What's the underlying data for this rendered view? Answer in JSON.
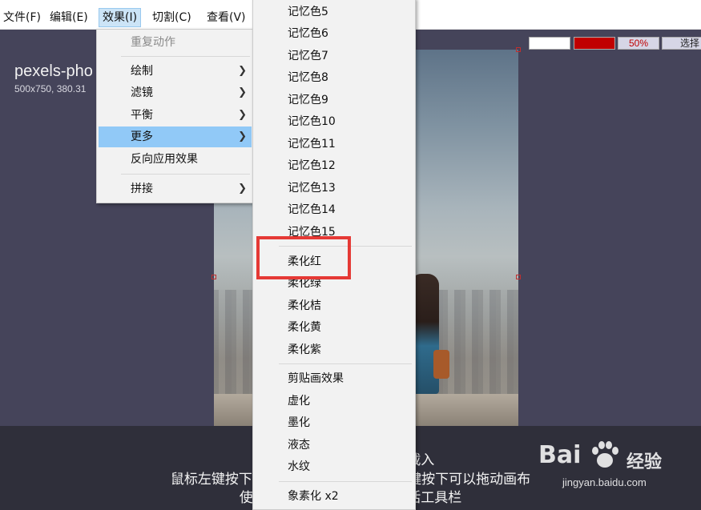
{
  "menubar": {
    "items": [
      {
        "label": "文件(F)"
      },
      {
        "label": "编辑(E)"
      },
      {
        "label": "效果(I)"
      },
      {
        "label": "切割(C)"
      },
      {
        "label": "查看(V)"
      }
    ]
  },
  "image": {
    "title": "pexels-pho",
    "info": "500x750, 380.31"
  },
  "controls": {
    "zoom": "50%",
    "select": "选择",
    "swatch_white": "#ffffff",
    "swatch_red": "#c00000"
  },
  "effects_menu": {
    "items": [
      {
        "label": "重复动作",
        "disabled": true
      },
      {
        "label": "绘制",
        "submenu": true
      },
      {
        "label": "滤镜",
        "submenu": true
      },
      {
        "label": "平衡",
        "submenu": true
      },
      {
        "label": "更多",
        "submenu": true,
        "highlighted": true
      },
      {
        "label": "反向应用效果"
      },
      {
        "label": "拼接",
        "submenu": true
      }
    ]
  },
  "more_submenu": {
    "items": [
      "记忆色5",
      "记忆色6",
      "记忆色7",
      "记忆色8",
      "记忆色9",
      "记忆色10",
      "记忆色11",
      "记忆色12",
      "记忆色13",
      "记忆色14",
      "记忆色15",
      "柔化红",
      "柔化绿",
      "柔化桔",
      "柔化黄",
      "柔化紫",
      "剪贴画效果",
      "虚化",
      "墨化",
      "液态",
      "水纹",
      "象素化 x2"
    ]
  },
  "hints": {
    "line1": "点击任何          放到窗体重新载入",
    "line2": "鼠标左键按下拖放选择需                  hift + 鼠标右键按下可以拖动画布",
    "line3": "使用鼠标滚轮                        界面左上角激活工具栏"
  },
  "watermark": {
    "logo": "Bai   ",
    "jingyan": "经验",
    "url": "jingyan.baidu.com"
  }
}
